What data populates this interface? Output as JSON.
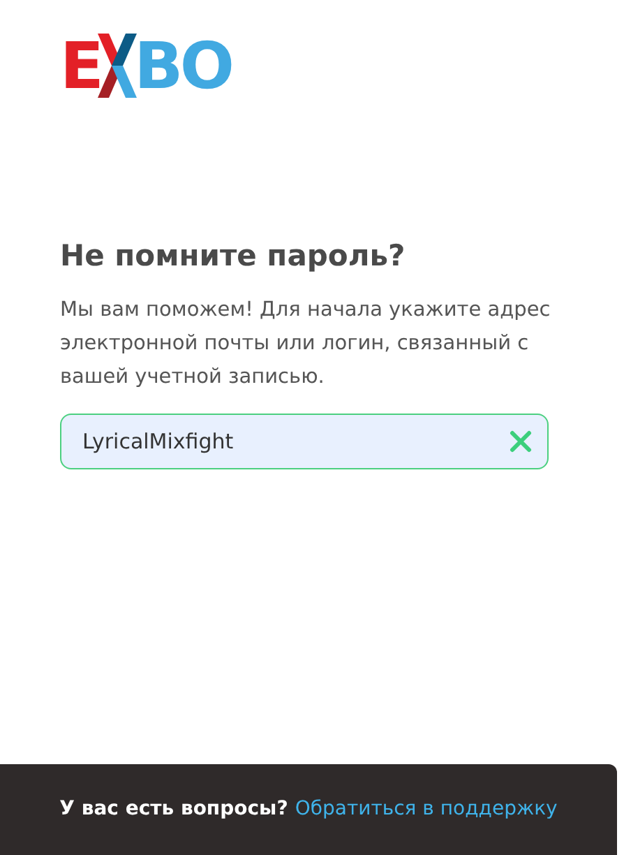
{
  "logo": {
    "left": "E",
    "right": "BO"
  },
  "heading": "Не помните пароль?",
  "description": "Мы вам поможем! Для начала укажите адрес электронной почты или логин, связанный с вашей учетной записью.",
  "login_field": {
    "value": "LyricalMixfight",
    "valid": true
  },
  "footer": {
    "question": "У вас есть вопросы?",
    "link": "Обратиться в поддержку"
  }
}
